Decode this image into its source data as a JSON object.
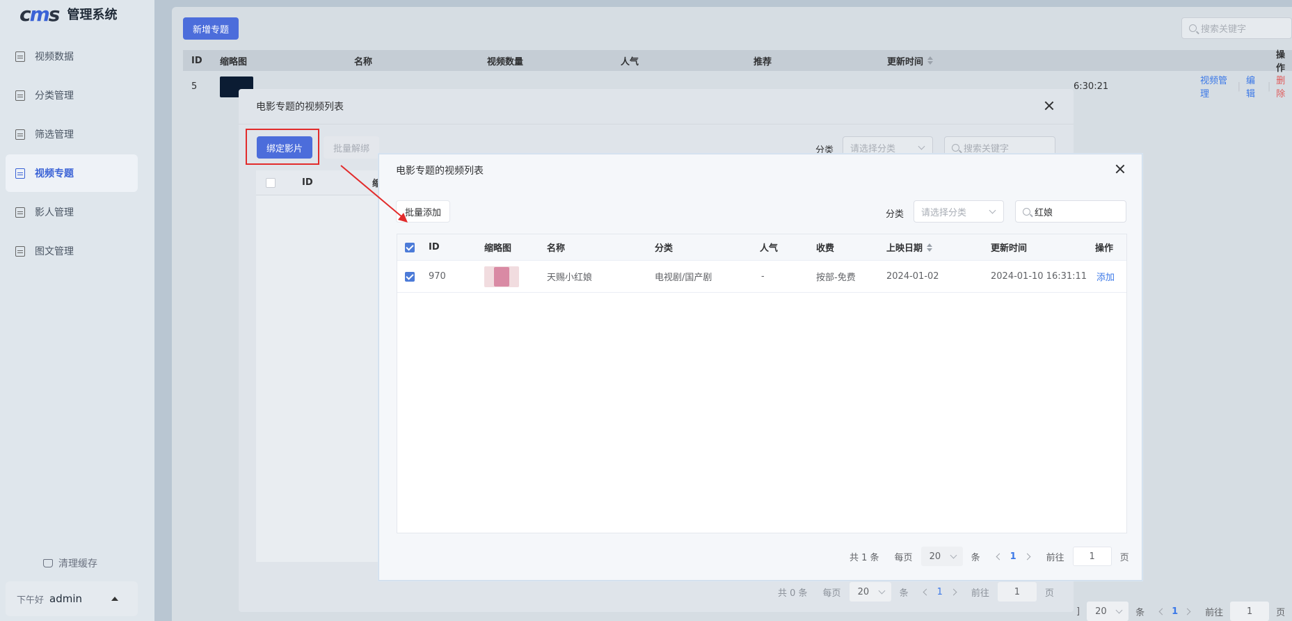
{
  "sidebar": {
    "logo_text_a": "c",
    "logo_text_b": "m",
    "logo_text_c": "s",
    "app_title": "管理系统",
    "items": [
      {
        "label": "视频数据",
        "active": false
      },
      {
        "label": "分类管理",
        "active": false
      },
      {
        "label": "筛选管理",
        "active": false
      },
      {
        "label": "视频专题",
        "active": true
      },
      {
        "label": "影人管理",
        "active": false
      },
      {
        "label": "图文管理",
        "active": false
      }
    ],
    "clear_cache": "清理缓存",
    "greeting": "下午好",
    "username": "admin"
  },
  "main": {
    "add_button": "新增专题",
    "search_placeholder": "搜索关键字",
    "columns": [
      "ID",
      "缩略图",
      "名称",
      "视频数量",
      "人气",
      "推荐",
      "更新时间",
      "操作"
    ],
    "row": {
      "id": "5",
      "updated_partial": "6:30:21",
      "action_videos": "视频管理",
      "action_edit": "编辑",
      "action_delete": "删除"
    },
    "pager": {
      "page_size": "20",
      "per_unit": "条",
      "page": "1",
      "goto_label": "前往",
      "goto_value": "1",
      "page_unit": "页",
      "partial_left": "]"
    }
  },
  "dialog1": {
    "title": "电影专题的视频列表",
    "bind_button": "绑定影片",
    "unbind_button": "批量解绑",
    "category_label": "分类",
    "category_placeholder": "请选择分类",
    "search_placeholder": "搜索关键字",
    "col_id": "ID",
    "col_partial": "缩",
    "pager": {
      "total": "共 0 条",
      "per_label": "每页",
      "page_size": "20",
      "per_unit": "条",
      "page": "1",
      "goto_label": "前往",
      "goto_value": "1",
      "page_unit": "页"
    }
  },
  "dialog2": {
    "title": "电影专题的视频列表",
    "batch_add_button": "批量添加",
    "category_label": "分类",
    "category_placeholder": "请选择分类",
    "search_value": "红娘",
    "columns": {
      "id": "ID",
      "thumb": "缩略图",
      "name": "名称",
      "category": "分类",
      "popularity": "人气",
      "charge": "收费",
      "release": "上映日期",
      "updated": "更新时间",
      "action": "操作"
    },
    "rows": [
      {
        "id": "970",
        "name": "天赐小红娘",
        "category": "电视剧/国产剧",
        "popularity": "-",
        "charge": "按部-免费",
        "release": "2024-01-02",
        "updated": "2024-01-10 16:31:11",
        "action": "添加",
        "checked": true
      }
    ],
    "pager": {
      "total": "共 1 条",
      "per_label": "每页",
      "page_size": "20",
      "per_unit": "条",
      "page": "1",
      "goto_label": "前往",
      "goto_value": "1",
      "page_unit": "页"
    }
  },
  "colors": {
    "primary": "#4c6ddb",
    "link": "#3b78e7",
    "danger": "#e05a5a",
    "annotation": "#e22b2b"
  }
}
